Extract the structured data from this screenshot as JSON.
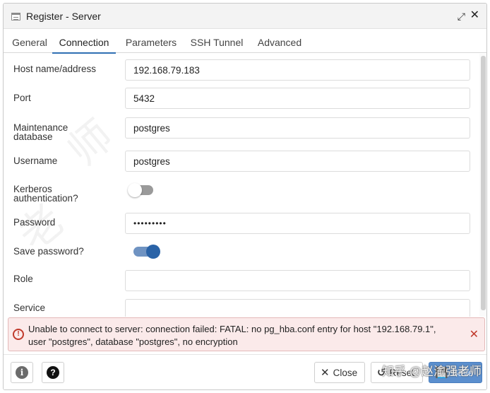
{
  "window": {
    "title": "Register - Server",
    "expand_icon": "expand-icon",
    "close_icon": "close-icon"
  },
  "tabs": [
    {
      "label": "General",
      "active": false
    },
    {
      "label": "Connection",
      "active": true
    },
    {
      "label": "Parameters",
      "active": false
    },
    {
      "label": "SSH Tunnel",
      "active": false
    },
    {
      "label": "Advanced",
      "active": false
    }
  ],
  "form": {
    "host": {
      "label": "Host name/address",
      "value": "192.168.79.183"
    },
    "port": {
      "label": "Port",
      "value": "5432"
    },
    "maintenance_db": {
      "label_line1": "Maintenance",
      "label_line2": "database",
      "value": "postgres"
    },
    "username": {
      "label": "Username",
      "value": "postgres"
    },
    "kerberos": {
      "label_line1": "Kerberos",
      "label_line2": "authentication?",
      "enabled": false
    },
    "password": {
      "label": "Password",
      "value": "•••••••••"
    },
    "save_password": {
      "label": "Save password?",
      "enabled": true
    },
    "role": {
      "label": "Role",
      "value": ""
    },
    "service": {
      "label": "Service",
      "value": ""
    }
  },
  "error": {
    "line1": "Unable to connect to server: connection failed: FATAL: no pg_hba.conf entry for host \"192.168.79.1\",",
    "line2": "user \"postgres\", database \"postgres\", no encryption",
    "icon": "alert-circle-icon",
    "color": "#c0392b"
  },
  "footer": {
    "info_icon": "info-icon",
    "help_icon": "help-icon",
    "close_label": "Close",
    "reset_label": "Reset",
    "save_label": "Save"
  },
  "watermark": "知乎 @赵渝强老师",
  "colors": {
    "accent": "#2f6fb3",
    "save_button": "#5b8fce",
    "toggle_on": "#2a63a7"
  }
}
